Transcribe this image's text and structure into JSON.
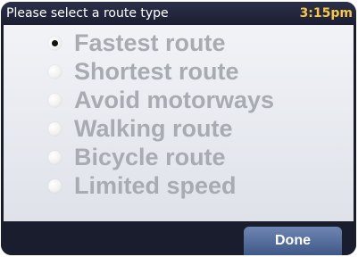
{
  "header": {
    "title": "Please select a route type",
    "time": "3:15pm"
  },
  "route_options": [
    {
      "label": "Fastest route",
      "selected": true
    },
    {
      "label": "Shortest route",
      "selected": false
    },
    {
      "label": "Avoid motorways",
      "selected": false
    },
    {
      "label": "Walking route",
      "selected": false
    },
    {
      "label": "Bicycle route",
      "selected": false
    },
    {
      "label": "Limited speed",
      "selected": false
    }
  ],
  "footer": {
    "done_label": "Done"
  },
  "colors": {
    "title_bar": "#1c1f33",
    "clock": "#f5c64a",
    "panel": "#e8eaf0",
    "option_text": "#a8abb2",
    "done_button": "#4f6898"
  }
}
